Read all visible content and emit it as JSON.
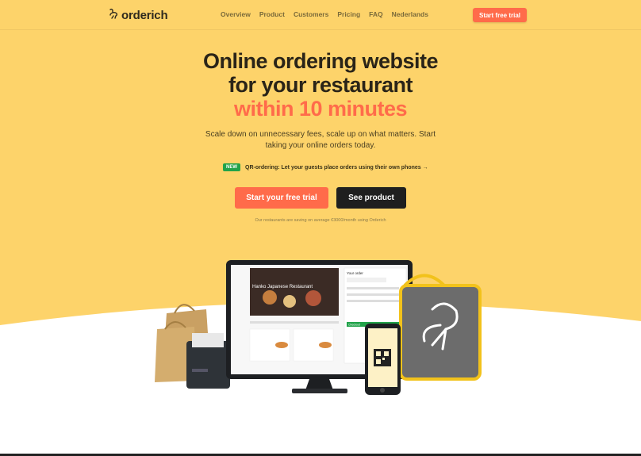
{
  "brand": {
    "name": "orderich",
    "primary_color": "#ff6b4a",
    "hero_bg": "#fdd36a",
    "badge_color": "#22a34a"
  },
  "nav": {
    "links": [
      "Overview",
      "Product",
      "Customers",
      "Pricing",
      "FAQ",
      "Nederlands"
    ],
    "cta_label": "Start free trial"
  },
  "hero": {
    "title_line1": "Online ordering website",
    "title_line2": "for your restaurant",
    "title_highlight": "within 10 minutes",
    "subtitle": "Scale down on unnecessary fees, scale up on what matters. Start taking your online orders today.",
    "announcement": {
      "badge": "NEW",
      "text": "QR-ordering: Let your guests place orders using their own phones →"
    },
    "primary_button": "Start your free trial",
    "secondary_button": "See product",
    "note": "Our restaurants are saving on average €3000/month using Orderich"
  },
  "illustration": {
    "monitor": {
      "restaurant_name": "Hanko Japanese Restaurant",
      "order_panel_title": "Your order",
      "checkout_label": "Checkout"
    },
    "icons": [
      "shopping-bag-icon",
      "receipt-printer-icon",
      "monitor-icon",
      "phone-qr-icon",
      "delivery-backpack-icon"
    ]
  }
}
